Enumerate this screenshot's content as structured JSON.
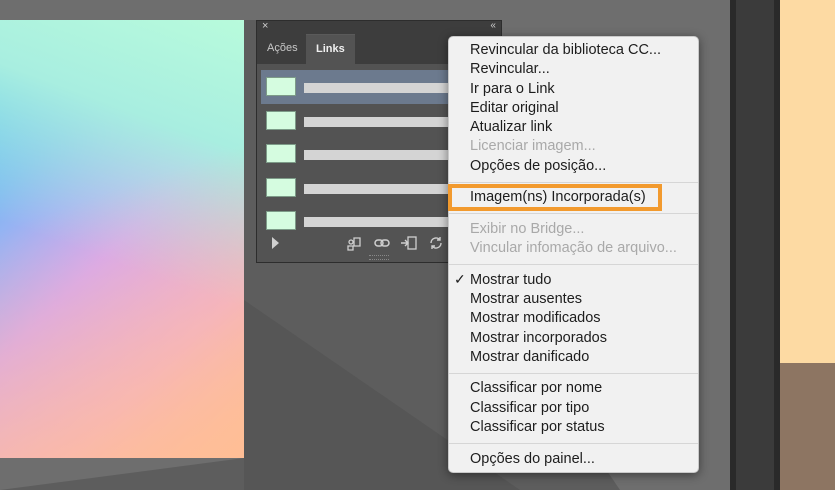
{
  "panel": {
    "tabs": [
      "Ações",
      "Links"
    ],
    "close_glyph": "×",
    "collapse_glyph": "‹‹",
    "footer_icons": [
      "play-icon",
      "relink-cc-icon",
      "link-icon",
      "goto-link-icon",
      "update-link-icon"
    ]
  },
  "menu": {
    "items": [
      "Revincular da biblioteca CC...",
      "Revincular...",
      "Ir para o Link",
      "Editar original",
      "Atualizar link",
      "Licenciar imagem...",
      "Opções de posição...",
      "Imagem(ns) Incorporada(s)",
      "Exibir no Bridge...",
      "Vincular infomação de arquivo...",
      "Mostrar tudo",
      "Mostrar ausentes",
      "Mostrar modificados",
      "Mostrar incorporados",
      "Mostrar danificado",
      "Classificar por nome",
      "Classificar por tipo",
      "Classificar por status",
      "Opções do painel..."
    ],
    "disabled": [
      "Licenciar imagem...",
      "Exibir no Bridge...",
      "Vincular infomação de arquivo..."
    ],
    "checked": "Mostrar tudo",
    "check_glyph": "✓"
  },
  "colors": {
    "highlight": "#f29a2e",
    "selected_row": "#6c7a8e"
  }
}
